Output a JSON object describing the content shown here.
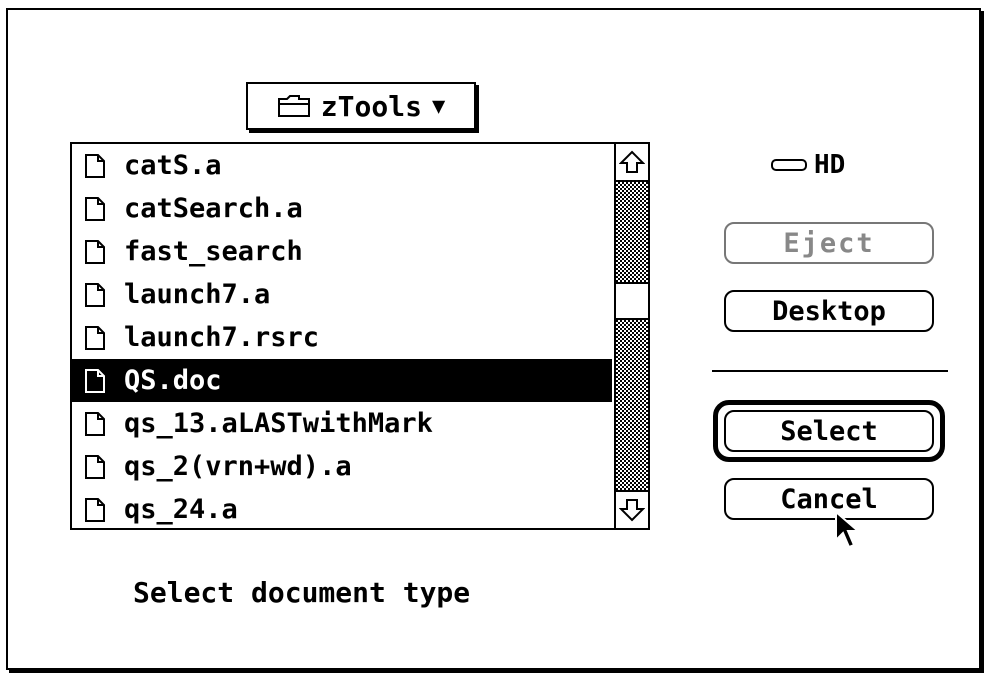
{
  "popup": {
    "folder_name": "zTools",
    "folder_icon": "folder-icon",
    "arrow": "▼"
  },
  "files": [
    {
      "name": "catS.a",
      "selected": false
    },
    {
      "name": "catSearch.a",
      "selected": false
    },
    {
      "name": "fast_search",
      "selected": false
    },
    {
      "name": "launch7.a",
      "selected": false
    },
    {
      "name": "launch7.rsrc",
      "selected": false
    },
    {
      "name": "QS.doc",
      "selected": true
    },
    {
      "name": "qs_13.aLASTwithMark",
      "selected": false
    },
    {
      "name": "qs_2(vrn+wd).a",
      "selected": false
    },
    {
      "name": "qs_24.a",
      "selected": false
    }
  ],
  "prompt": "Select document type",
  "disk": {
    "name": "HD",
    "icon": "hard-disk-icon"
  },
  "buttons": {
    "eject": "Eject",
    "desktop": "Desktop",
    "select": "Select",
    "cancel": "Cancel"
  },
  "colors": {
    "selection": "#000000",
    "disabled": "#888888"
  }
}
